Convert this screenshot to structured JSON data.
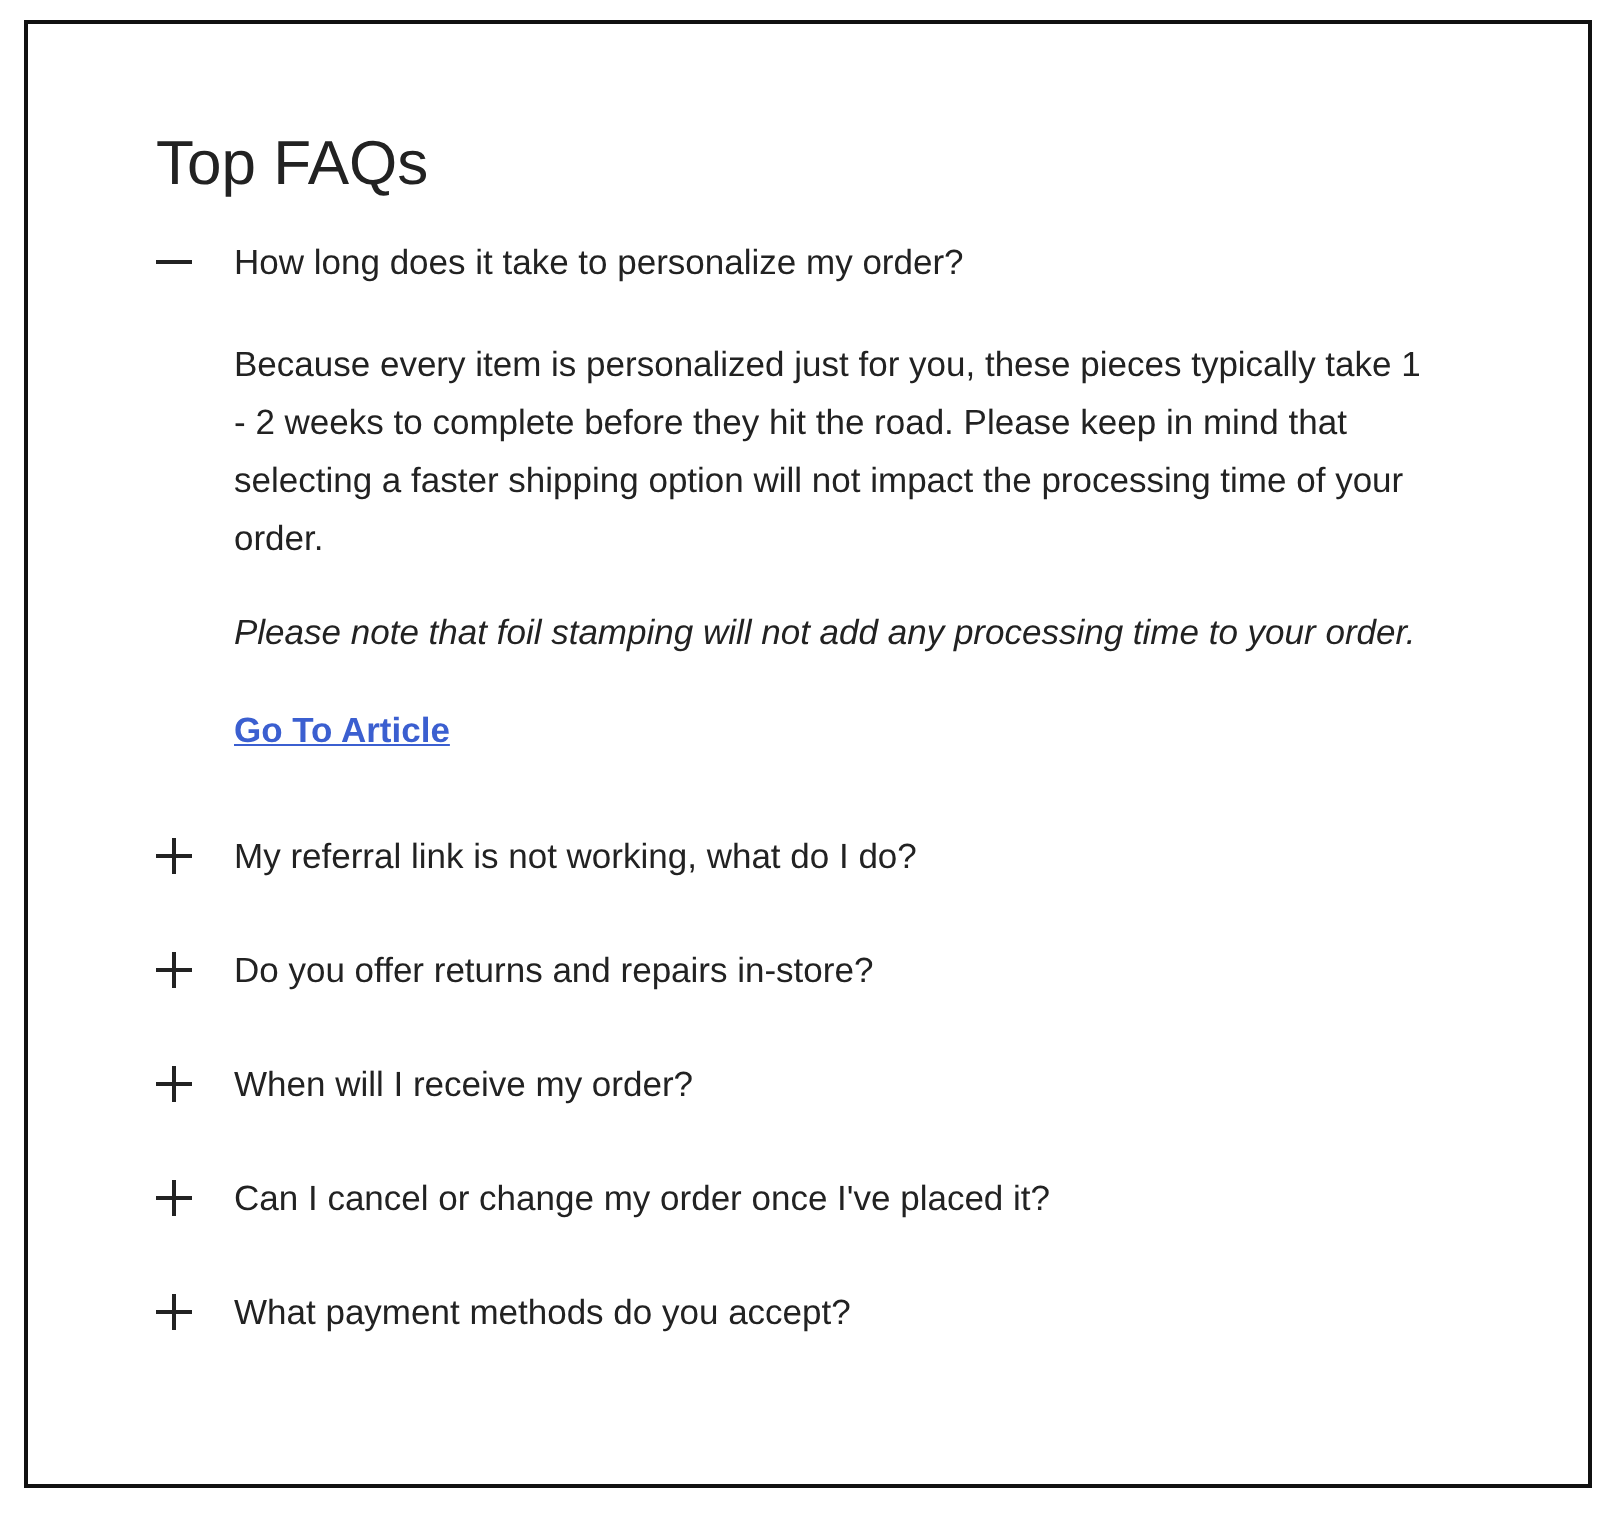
{
  "title": "Top FAQs",
  "faqs": [
    {
      "question": "How long does it take to personalize my order?",
      "expanded": true,
      "answer": [
        {
          "kind": "plain",
          "text": "Because every item is personalized just for you, these pieces typically take 1 - 2 weeks to complete before they hit the road. Please keep in mind that selecting a faster shipping option will not impact the processing time of your order."
        },
        {
          "kind": "italic",
          "text": "Please note that foil stamping will not add any processing time to your order."
        }
      ],
      "link": "Go To Article"
    },
    {
      "question": "My referral link is not working, what do I do?",
      "expanded": false
    },
    {
      "question": "Do you offer returns and repairs in-store?",
      "expanded": false
    },
    {
      "question": "When will I receive my order?",
      "expanded": false
    },
    {
      "question": "Can I cancel or change my order once I've placed it?",
      "expanded": false
    },
    {
      "question": "What payment methods do you accept?",
      "expanded": false
    }
  ]
}
